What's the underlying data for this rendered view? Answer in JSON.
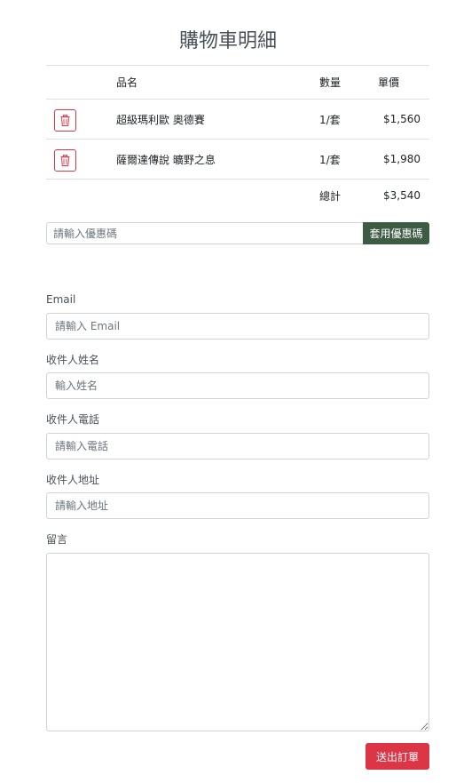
{
  "page": {
    "title": "購物車明細"
  },
  "cart": {
    "headers": {
      "name": "品名",
      "qty": "數量",
      "price": "單價"
    },
    "items": [
      {
        "name": "超級瑪利歐 奧德賽",
        "qty": "1/套",
        "price": "$1,560"
      },
      {
        "name": "薩爾達傳說 曠野之息",
        "qty": "1/套",
        "price": "$1,980"
      }
    ],
    "total_label": "總計",
    "total_value": "$3,540"
  },
  "coupon": {
    "placeholder": "請輸入優惠碼",
    "button_label": "套用優惠碼"
  },
  "form": {
    "email": {
      "label": "Email",
      "placeholder": "請輸入 Email"
    },
    "name": {
      "label": "收件人姓名",
      "placeholder": "輸入姓名"
    },
    "phone": {
      "label": "收件人電話",
      "placeholder": "請輸入電話"
    },
    "address": {
      "label": "收件人地址",
      "placeholder": "請輸入地址"
    },
    "message": {
      "label": "留言",
      "placeholder": ""
    }
  },
  "submit_label": "送出訂單",
  "colors": {
    "danger": "#dc3545",
    "coupon_button": "#3e5b44",
    "border": "#dee2e6"
  },
  "icons": {
    "delete": "trash-icon"
  }
}
